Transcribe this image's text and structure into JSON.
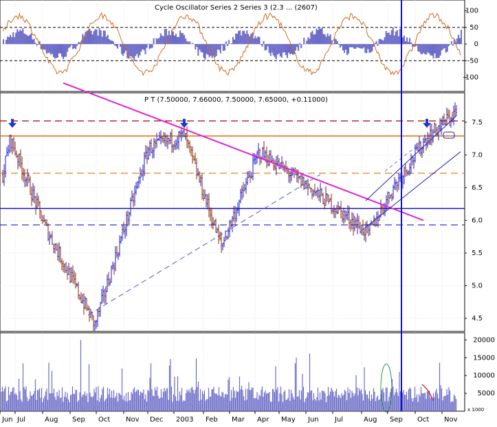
{
  "chart_data": [
    {
      "panel": "oscillator",
      "type": "bar",
      "title_text": "Cycle Oscillator Series 2 Series 3 (2.3 ... (2607)",
      "yticks": [
        100,
        50,
        0,
        -50,
        -100
      ],
      "ylim": [
        -130,
        120
      ],
      "reference_lines": [
        50,
        -50
      ],
      "series": [
        {
          "kind": "histogram",
          "color": "#6b6bc8"
        },
        {
          "kind": "line",
          "color": "#d2691e"
        }
      ]
    },
    {
      "panel": "price",
      "type": "candlestick",
      "title_text": "P T (7.50000, 7.66000, 7.50000, 7.65000, +0.11000)",
      "yticks": [
        "7.5",
        "7.0",
        "6.5",
        "6.0",
        "5.5",
        "5.0",
        "4.5"
      ],
      "ylim": [
        4.3,
        7.95
      ],
      "horizontal_lines": [
        {
          "value": 7.52,
          "style": "dash",
          "color": "#aa0000"
        },
        {
          "value": 7.29,
          "style": "solid",
          "color": "#e07000"
        },
        {
          "value": 6.72,
          "style": "dash",
          "color": "#e07000"
        },
        {
          "value": 6.18,
          "style": "solid",
          "color": "#1a1ad0"
        },
        {
          "value": 5.93,
          "style": "dash",
          "color": "#1a1ad0"
        }
      ],
      "trendline": {
        "color": "#e020d0",
        "from": {
          "month": "Jun 2002",
          "value": 8.1
        },
        "to": {
          "month": "Sep 2003",
          "value": 6.0
        }
      },
      "support_line": {
        "color": "#5555cc",
        "from": {
          "month": "Oct 2002",
          "value": 4.55
        },
        "to": {
          "month": "Jun 2003",
          "value": 6.7
        }
      },
      "channel": {
        "color": "#1a1ad0",
        "from": {
          "month": "Aug 2003",
          "value": 5.85
        },
        "to": {
          "month": "Nov 2003",
          "value": 7.6
        }
      },
      "arrows_at": [
        "Jun 2002",
        "Jan 2003",
        "Oct 2003"
      ],
      "key_points": [
        {
          "month": "Jun",
          "value": 7.25
        },
        {
          "month": "Aug",
          "value": 5.9
        },
        {
          "month": "Sep",
          "value": 4.4
        },
        {
          "month": "Dec",
          "value": 7.1
        },
        {
          "month": "2003",
          "value": 7.3
        },
        {
          "month": "Feb",
          "value": 5.6
        },
        {
          "month": "Apr",
          "value": 7.05
        },
        {
          "month": "Jun",
          "value": 6.5
        },
        {
          "month": "Aug",
          "value": 5.8
        },
        {
          "month": "Sep",
          "value": 6.5
        },
        {
          "month": "Oct",
          "value": 7.25
        },
        {
          "month": "Nov",
          "value": 7.65
        }
      ]
    },
    {
      "panel": "volume",
      "type": "bar",
      "title_text": "",
      "yticks": [
        "20000",
        "15000",
        "10000",
        "5000"
      ],
      "ylim": [
        0,
        22000
      ],
      "peak_value": 20000,
      "unit_label": "x 1000",
      "color": "#6b6bc8"
    }
  ],
  "x_axis": {
    "labels": [
      "Jun",
      "Jul",
      "Aug",
      "Sep",
      "Oct",
      "Nov",
      "Dec",
      "2003",
      "Feb",
      "Mar",
      "Apr",
      "May",
      "Jun",
      "Jul",
      "Aug",
      "Sep",
      "Oct",
      "Nov"
    ]
  },
  "cursor_month": "Sep 2003",
  "colors": {
    "up": "#1a1acc",
    "down": "#8b2500",
    "grid": "#c8c8c8",
    "cursor": "#1010cc"
  }
}
